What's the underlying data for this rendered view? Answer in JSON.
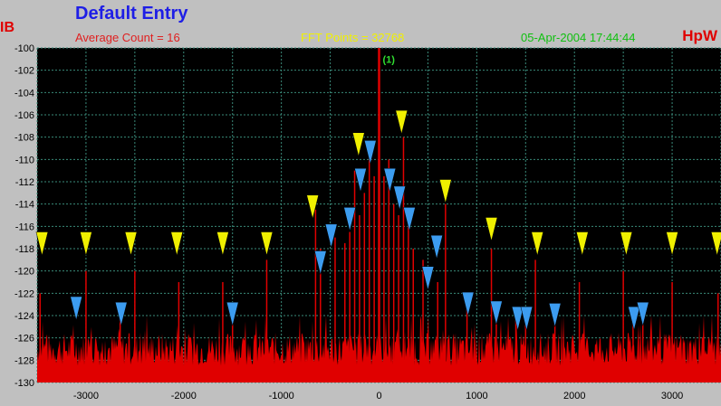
{
  "header": {
    "title": "Default Entry",
    "average_count": "Average Count = 16",
    "fft_points": "FFT Points = 32768",
    "timestamp": "05-Apr-2004 17:44:44",
    "y_unit_left": "IB",
    "y_unit_right": "HpW"
  },
  "colors": {
    "plot_bg": "#000000",
    "grid": "#3a8a7a",
    "trace": "#e00000",
    "yellow_marker": "#f0f000",
    "blue_marker": "#3c9cf0",
    "marker_label": "#30e030",
    "axis_text": "#000000"
  },
  "chart_data": {
    "type": "line",
    "title": "Default Entry",
    "xlim": [
      -3500,
      3500
    ],
    "ylim": [
      -130,
      -100
    ],
    "xticks": [
      -3000,
      -2000,
      -1000,
      0,
      1000,
      2000,
      3000
    ],
    "yticks": [
      -100,
      -102,
      -104,
      -106,
      -108,
      -110,
      -112,
      -114,
      -116,
      -118,
      -120,
      -122,
      -124,
      -126,
      -128,
      -130
    ],
    "grid": true,
    "noise_floor_db": -128.5,
    "series": [
      {
        "kind": "spectral-lines",
        "lines": [
          {
            "x": 0,
            "y": -100
          },
          {
            "x": -50,
            "y": -111.5
          },
          {
            "x": 50,
            "y": -111.5
          },
          {
            "x": -100,
            "y": -108.5
          },
          {
            "x": 100,
            "y": -110
          },
          {
            "x": -150,
            "y": -113
          },
          {
            "x": 150,
            "y": -114
          },
          {
            "x": -200,
            "y": -115
          },
          {
            "x": 200,
            "y": -115
          },
          {
            "x": -250,
            "y": -111
          },
          {
            "x": 250,
            "y": -108
          },
          {
            "x": -300,
            "y": -116.5
          },
          {
            "x": 300,
            "y": -115
          },
          {
            "x": -350,
            "y": -117.5
          },
          {
            "x": 350,
            "y": -118
          },
          {
            "x": -450,
            "y": -117
          },
          {
            "x": 450,
            "y": -119
          },
          {
            "x": -600,
            "y": -118
          },
          {
            "x": 600,
            "y": -121
          },
          {
            "x": -650,
            "y": -114.5
          },
          {
            "x": 680,
            "y": -114
          },
          {
            "x": -1150,
            "y": -119
          },
          {
            "x": 1150,
            "y": -118
          },
          {
            "x": -1600,
            "y": -121
          },
          {
            "x": 1600,
            "y": -119
          },
          {
            "x": -2050,
            "y": -121
          },
          {
            "x": 2050,
            "y": -121
          },
          {
            "x": -2500,
            "y": -120
          },
          {
            "x": 2500,
            "y": -120
          },
          {
            "x": -3000,
            "y": -120
          },
          {
            "x": 3000,
            "y": -121
          },
          {
            "x": -3470,
            "y": -122
          },
          {
            "x": 3470,
            "y": -122
          },
          {
            "x": -2650,
            "y": -124
          },
          {
            "x": -1500,
            "y": -124
          },
          {
            "x": 900,
            "y": -123
          },
          {
            "x": 1200,
            "y": -123
          },
          {
            "x": 1400,
            "y": -124
          },
          {
            "x": 1500,
            "y": -124
          },
          {
            "x": 1800,
            "y": -124
          },
          {
            "x": 2600,
            "y": -124
          },
          {
            "x": 2700,
            "y": -123
          }
        ]
      }
    ],
    "markers": {
      "peak_label": {
        "x": 0,
        "y": -101,
        "text": "(1)"
      },
      "yellow": [
        {
          "x": -3450,
          "y": -116.5
        },
        {
          "x": -3000,
          "y": -116.5
        },
        {
          "x": -2540,
          "y": -116.5
        },
        {
          "x": -2070,
          "y": -116.5
        },
        {
          "x": -1600,
          "y": -116.5
        },
        {
          "x": -1150,
          "y": -116.5
        },
        {
          "x": -680,
          "y": -113.2
        },
        {
          "x": -210,
          "y": -107.6
        },
        {
          "x": 230,
          "y": -105.6
        },
        {
          "x": 680,
          "y": -111.8
        },
        {
          "x": 1150,
          "y": -115.2
        },
        {
          "x": 1620,
          "y": -116.5
        },
        {
          "x": 2080,
          "y": -116.5
        },
        {
          "x": 2530,
          "y": -116.5
        },
        {
          "x": 3000,
          "y": -116.5
        },
        {
          "x": 3460,
          "y": -116.5
        }
      ],
      "blue": [
        {
          "x": -3100,
          "y": -122.3
        },
        {
          "x": -2640,
          "y": -122.8
        },
        {
          "x": -1500,
          "y": -122.8
        },
        {
          "x": -600,
          "y": -118.2
        },
        {
          "x": -490,
          "y": -115.8
        },
        {
          "x": -300,
          "y": -114.3
        },
        {
          "x": -190,
          "y": -110.8
        },
        {
          "x": -90,
          "y": -108.3
        },
        {
          "x": 110,
          "y": -110.8
        },
        {
          "x": 210,
          "y": -112.4
        },
        {
          "x": 310,
          "y": -114.3
        },
        {
          "x": 500,
          "y": -119.6
        },
        {
          "x": 590,
          "y": -116.8
        },
        {
          "x": 910,
          "y": -121.9
        },
        {
          "x": 1200,
          "y": -122.7
        },
        {
          "x": 1420,
          "y": -123.2
        },
        {
          "x": 1510,
          "y": -123.2
        },
        {
          "x": 1800,
          "y": -122.9
        },
        {
          "x": 2610,
          "y": -123.2
        },
        {
          "x": 2700,
          "y": -122.8
        }
      ]
    }
  }
}
